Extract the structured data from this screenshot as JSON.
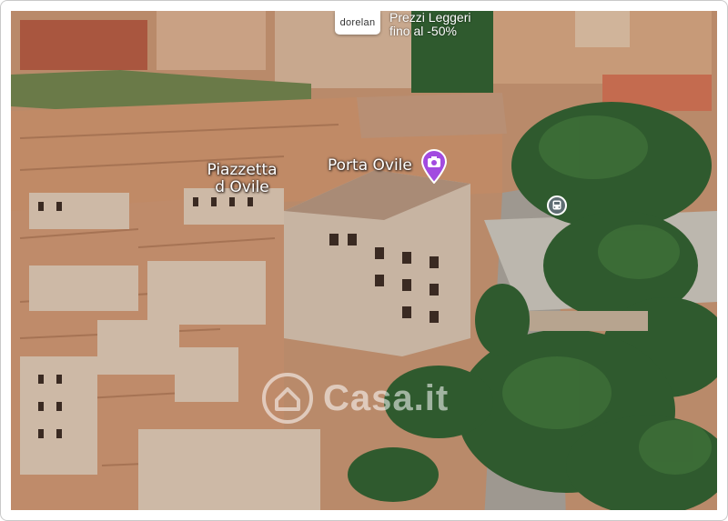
{
  "map": {
    "labels": {
      "piazzetta_line1": "Piazzetta",
      "piazzetta_line2": "d Ovile",
      "porta_ovile": "Porta Ovile"
    },
    "icons": {
      "poi": "camera-pin-icon",
      "transit": "bus-stop-icon"
    },
    "colors": {
      "poi_pin": "#a24be0",
      "roof": "#c08a66",
      "wall": "#cdb9a6",
      "vegetation": "#2f5a2e"
    }
  },
  "ad": {
    "brand": "dorelan",
    "line1": "Prezzi Leggeri",
    "line2": "fino al -50%"
  },
  "watermark": {
    "text": "Casa.it"
  }
}
